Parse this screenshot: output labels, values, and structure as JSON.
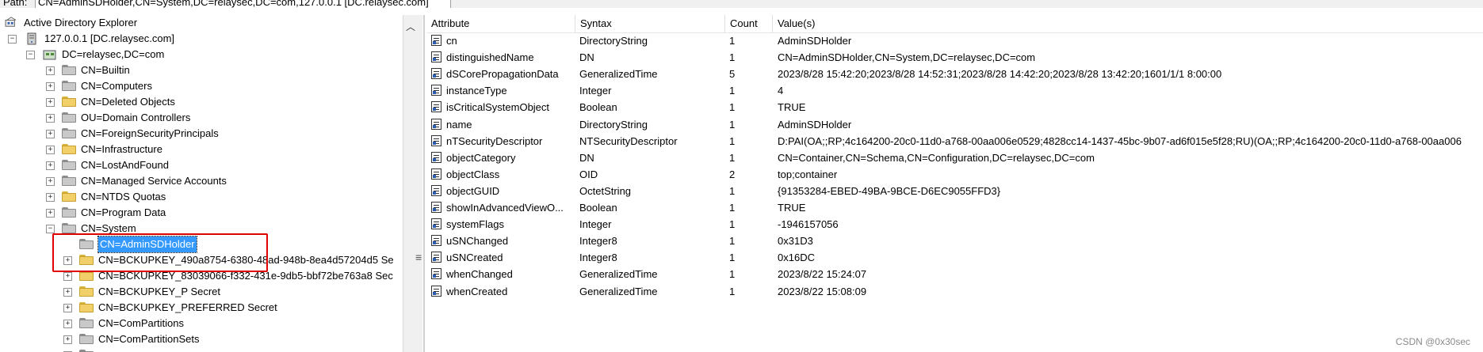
{
  "path": {
    "label": "Path:",
    "value": "CN=AdminSDHolder,CN=System,DC=relaysec,DC=com,127.0.0.1 [DC.relaysec.com]"
  },
  "tree": {
    "root_label": "Active Directory Explorer",
    "server_label": "127.0.0.1 [DC.relaysec.com]",
    "domain_label": "DC=relaysec,DC=com",
    "children": [
      {
        "label": "CN=Builtin",
        "icon": "gray-folder-icon"
      },
      {
        "label": "CN=Computers",
        "icon": "gray-folder-icon"
      },
      {
        "label": "CN=Deleted Objects",
        "icon": "yellow-folder-icon"
      },
      {
        "label": "OU=Domain Controllers",
        "icon": "ou-folder-icon"
      },
      {
        "label": "CN=ForeignSecurityPrincipals",
        "icon": "gray-folder-icon"
      },
      {
        "label": "CN=Infrastructure",
        "icon": "yellow-folder-icon"
      },
      {
        "label": "CN=LostAndFound",
        "icon": "gray-folder-icon"
      },
      {
        "label": "CN=Managed Service Accounts",
        "icon": "gray-folder-icon"
      },
      {
        "label": "CN=NTDS Quotas",
        "icon": "yellow-folder-icon"
      },
      {
        "label": "CN=Program Data",
        "icon": "gray-folder-icon"
      },
      {
        "label": "CN=System",
        "icon": "gray-folder-icon"
      }
    ],
    "system_children": [
      {
        "label": "CN=AdminSDHolder",
        "icon": "gray-folder-icon",
        "selected": true
      },
      {
        "label": "CN=BCKUPKEY_490a8754-6380-48ad-948b-8ea4d57204d5 Se",
        "icon": "yellow-folder-icon"
      },
      {
        "label": "CN=BCKUPKEY_83039066-f332-431e-9db5-bbf72be763a8 Sec",
        "icon": "yellow-folder-icon"
      },
      {
        "label": "CN=BCKUPKEY_P Secret",
        "icon": "yellow-folder-icon"
      },
      {
        "label": "CN=BCKUPKEY_PREFERRED Secret",
        "icon": "yellow-folder-icon"
      },
      {
        "label": "CN=ComPartitions",
        "icon": "gray-folder-icon"
      },
      {
        "label": "CN=ComPartitionSets",
        "icon": "gray-folder-icon"
      }
    ]
  },
  "list": {
    "columns": [
      "Attribute",
      "Syntax",
      "Count",
      "Value(s)"
    ],
    "rows": [
      {
        "attribute": "cn",
        "syntax": "DirectoryString",
        "count": "1",
        "value": "AdminSDHolder"
      },
      {
        "attribute": "distinguishedName",
        "syntax": "DN",
        "count": "1",
        "value": "CN=AdminSDHolder,CN=System,DC=relaysec,DC=com"
      },
      {
        "attribute": "dSCorePropagationData",
        "syntax": "GeneralizedTime",
        "count": "5",
        "value": "2023/8/28 15:42:20;2023/8/28 14:52:31;2023/8/28 14:42:20;2023/8/28 13:42:20;1601/1/1 8:00:00"
      },
      {
        "attribute": "instanceType",
        "syntax": "Integer",
        "count": "1",
        "value": "4"
      },
      {
        "attribute": "isCriticalSystemObject",
        "syntax": "Boolean",
        "count": "1",
        "value": "TRUE"
      },
      {
        "attribute": "name",
        "syntax": "DirectoryString",
        "count": "1",
        "value": "AdminSDHolder"
      },
      {
        "attribute": "nTSecurityDescriptor",
        "syntax": "NTSecurityDescriptor",
        "count": "1",
        "value": "D:PAI(OA;;RP;4c164200-20c0-11d0-a768-00aa006e0529;4828cc14-1437-45bc-9b07-ad6f015e5f28;RU)(OA;;RP;4c164200-20c0-11d0-a768-00aa006"
      },
      {
        "attribute": "objectCategory",
        "syntax": "DN",
        "count": "1",
        "value": "CN=Container,CN=Schema,CN=Configuration,DC=relaysec,DC=com"
      },
      {
        "attribute": "objectClass",
        "syntax": "OID",
        "count": "2",
        "value": "top;container"
      },
      {
        "attribute": "objectGUID",
        "syntax": "OctetString",
        "count": "1",
        "value": "{91353284-EBED-49BA-9BCE-D6EC9055FFD3}"
      },
      {
        "attribute": "showInAdvancedViewO...",
        "syntax": "Boolean",
        "count": "1",
        "value": "TRUE"
      },
      {
        "attribute": "systemFlags",
        "syntax": "Integer",
        "count": "1",
        "value": "-1946157056"
      },
      {
        "attribute": "uSNChanged",
        "syntax": "Integer8",
        "count": "1",
        "value": "0x31D3"
      },
      {
        "attribute": "uSNCreated",
        "syntax": "Integer8",
        "count": "1",
        "value": "0x16DC"
      },
      {
        "attribute": "whenChanged",
        "syntax": "GeneralizedTime",
        "count": "1",
        "value": "2023/8/22 15:24:07"
      },
      {
        "attribute": "whenCreated",
        "syntax": "GeneralizedTime",
        "count": "1",
        "value": "2023/8/22 15:08:09"
      }
    ]
  },
  "watermark": "CSDN @0x30sec",
  "colors": {
    "selection": "#3399ff",
    "highlight_box": "#e00000",
    "folder_yellow": "#f1d06a",
    "folder_gray": "#c9c9c9"
  }
}
